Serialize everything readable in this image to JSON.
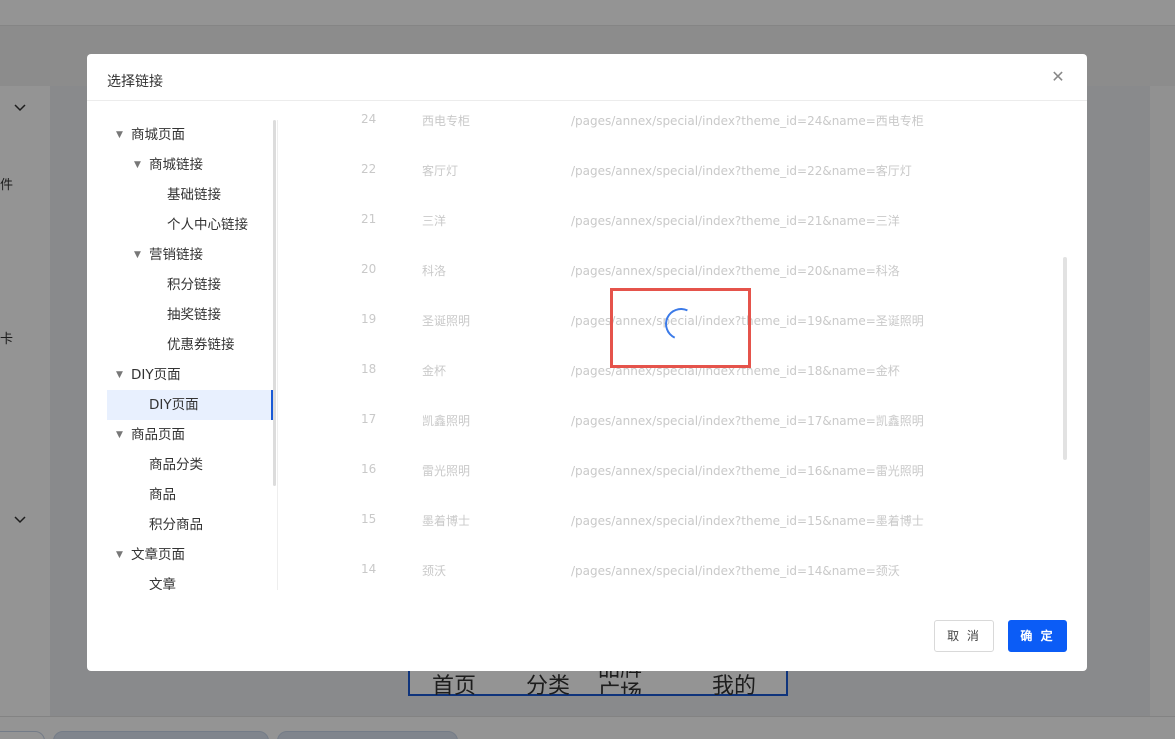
{
  "background": {
    "left_fragments": [
      "件",
      "卡"
    ],
    "phone_nav": [
      "首页",
      "分类",
      "品牌广场",
      "我的"
    ]
  },
  "dialog": {
    "title": "选择链接",
    "close_icon": "close-icon",
    "tree": [
      {
        "label": "商城页面",
        "level": 0,
        "expanded": true
      },
      {
        "label": "商城链接",
        "level": 1,
        "expanded": true
      },
      {
        "label": "基础链接",
        "level": 2
      },
      {
        "label": "个人中心链接",
        "level": 2
      },
      {
        "label": "营销链接",
        "level": 1,
        "expanded": true
      },
      {
        "label": "积分链接",
        "level": 2
      },
      {
        "label": "抽奖链接",
        "level": 2
      },
      {
        "label": "优惠券链接",
        "level": 2
      },
      {
        "label": "DIY页面",
        "level": 0,
        "expanded": true
      },
      {
        "label": "DIY页面",
        "level": 1,
        "active": true
      },
      {
        "label": "商品页面",
        "level": 0,
        "expanded": true
      },
      {
        "label": "商品分类",
        "level": 1
      },
      {
        "label": "商品",
        "level": 1
      },
      {
        "label": "积分商品",
        "level": 1
      },
      {
        "label": "文章页面",
        "level": 0,
        "expanded": true
      },
      {
        "label": "文章",
        "level": 1
      }
    ],
    "rows": [
      {
        "id": "24",
        "name": "西电专柜",
        "url": "/pages/annex/special/index?theme_id=24&name=西电专柜"
      },
      {
        "id": "22",
        "name": "客厅灯",
        "url": "/pages/annex/special/index?theme_id=22&name=客厅灯"
      },
      {
        "id": "21",
        "name": "三洋",
        "url": "/pages/annex/special/index?theme_id=21&name=三洋"
      },
      {
        "id": "20",
        "name": "科洛",
        "url": "/pages/annex/special/index?theme_id=20&name=科洛"
      },
      {
        "id": "19",
        "name": "圣诞照明",
        "url": "/pages/annex/special/index?theme_id=19&name=圣诞照明"
      },
      {
        "id": "18",
        "name": "金杯",
        "url": "/pages/annex/special/index?theme_id=18&name=金杯"
      },
      {
        "id": "17",
        "name": "凯鑫照明",
        "url": "/pages/annex/special/index?theme_id=17&name=凯鑫照明"
      },
      {
        "id": "16",
        "name": "雷光照明",
        "url": "/pages/annex/special/index?theme_id=16&name=雷光照明"
      },
      {
        "id": "15",
        "name": "墨着博士",
        "url": "/pages/annex/special/index?theme_id=15&name=墨着博士"
      },
      {
        "id": "14",
        "name": "颈沃",
        "url": "/pages/annex/special/index?theme_id=14&name=颈沃"
      }
    ],
    "cancel_label": "取 消",
    "ok_label": "确 定"
  },
  "colors": {
    "accent": "#0b5cf6",
    "highlight_box": "#e5534b",
    "spinner": "#3b7ae8"
  }
}
